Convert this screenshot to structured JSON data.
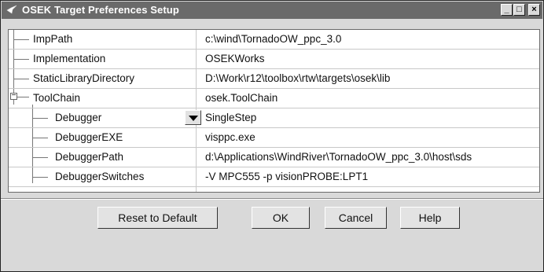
{
  "window": {
    "title": "OSEK Target Preferences Setup",
    "icon": "matlab-arrow-icon"
  },
  "titlebar_buttons": {
    "minimize": "_",
    "maximize": "□",
    "close": "×"
  },
  "rows": [
    {
      "name": "ImpPath",
      "value": "c:\\wind\\TornadoOW_ppc_3.0"
    },
    {
      "name": "Implementation",
      "value": "OSEKWorks"
    },
    {
      "name": "StaticLibraryDirectory",
      "value": "D:\\Work\\r12\\toolbox\\rtw\\targets\\osek\\lib"
    },
    {
      "name": "ToolChain",
      "value": "osek.ToolChain",
      "expander": "−"
    },
    {
      "name": "Debugger",
      "value": "SingleStep"
    },
    {
      "name": "DebuggerEXE",
      "value": "visppc.exe"
    },
    {
      "name": "DebuggerPath",
      "value": "d:\\Applications\\WindRiver\\TornadoOW_ppc_3.0\\host\\sds"
    },
    {
      "name": "DebuggerSwitches",
      "value": "-V MPC555 -p visionPROBE:LPT1"
    }
  ],
  "buttons": {
    "reset": "Reset to Default",
    "ok": "OK",
    "cancel": "Cancel",
    "help": "Help"
  }
}
